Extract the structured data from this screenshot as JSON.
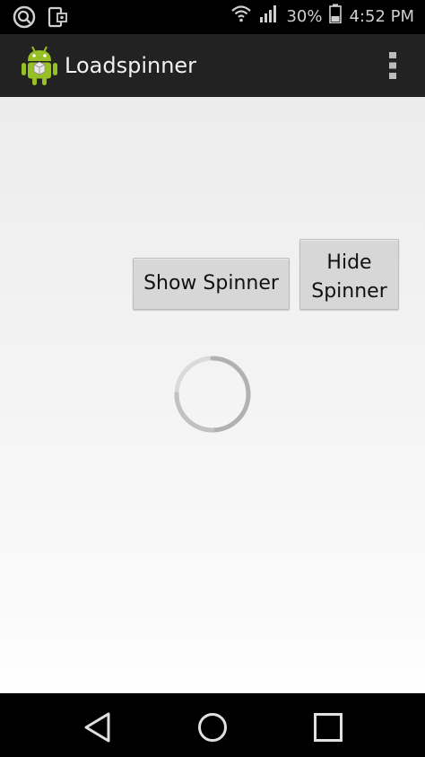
{
  "status_bar": {
    "battery": "30%",
    "time": "4:52 PM",
    "icons": [
      "search-icon",
      "phone-settings-icon",
      "wifi-icon",
      "signal-icon",
      "battery-icon"
    ]
  },
  "action_bar": {
    "title": "Loadspinner",
    "app_icon": "android-robot-icon",
    "menu_icon": "overflow-menu-icon",
    "background": "#222222"
  },
  "content": {
    "show_button_label": "Show Spinner",
    "hide_button_label": "Hide\nSpinner",
    "spinner": "loading-spinner"
  },
  "nav_bar": {
    "icons": [
      "back-icon",
      "home-icon",
      "recents-icon"
    ]
  },
  "colors": {
    "button_bg": "#d7d7d7",
    "spinner_track": "#d9d9d9",
    "spinner_arc": "#a8a8a8",
    "android_green": "#97c024"
  }
}
